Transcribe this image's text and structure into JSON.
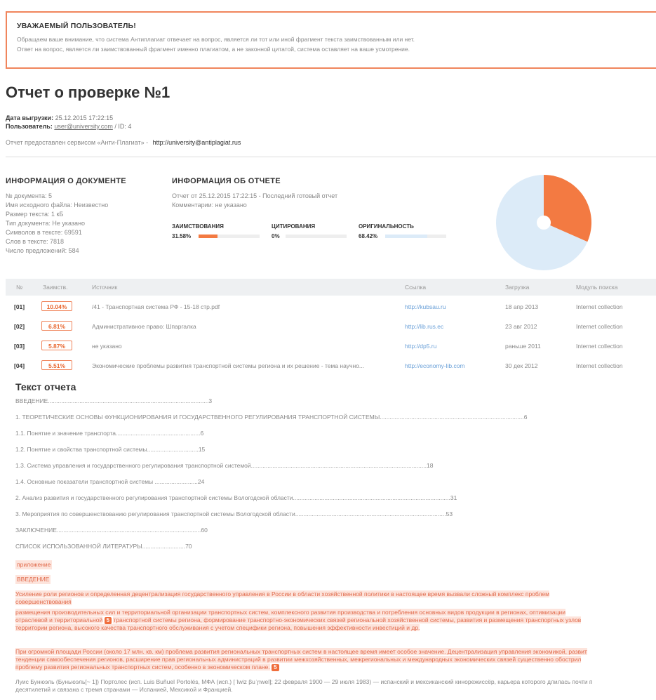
{
  "notice": {
    "title": "УВАЖАЕМЫЙ ПОЛЬЗОВАТЕЛЬ!",
    "line1": "Обращаем ваше внимание, что система Антиплагиат отвечает на вопрос, является ли тот или иной фрагмент текста заимствованным или нет.",
    "line2": "Ответ на вопрос, является ли заимствованный фрагмент именно плагиатом, а не законной цитатой, система оставляет на ваше усмотрение."
  },
  "report": {
    "title": "Отчет о проверке №1",
    "export_label": "Дата выгрузки:",
    "export_date": "25.12.2015 17:22:15",
    "user_label": "Пользователь:",
    "user_email": "user@university.com",
    "user_id": "/ ID: 4",
    "provided_text": "Отчет предоставлен сервисом «Анти-Плагиат» -",
    "provided_url": "http://university@antiplagiat.rus"
  },
  "doc_info": {
    "heading": "ИНФОРМАЦИЯ О ДОКУМЕНТЕ",
    "lines": [
      "№ документа: 5",
      "Имя исходного файла: Неизвестно",
      "Размер текста: 1 кБ",
      "Тип документа: Не указано",
      "Символов в тексте: 69591",
      "Слов в тексте: 7818",
      "Число предложений: 584"
    ]
  },
  "report_info": {
    "heading": "ИНФОРМАЦИЯ ОБ ОТЧЕТЕ",
    "line1": "Отчет от 25.12.2015 17:22:15 - Последний готовый отчет",
    "line2": "Комментарии: не указано",
    "metrics": [
      {
        "label": "ЗАИМСТВОВАНИЯ",
        "value": "31.58%",
        "fraction": 0.3158,
        "color": "#f37a42"
      },
      {
        "label": "ЦИТИРОВАНИЯ",
        "value": "0%",
        "fraction": 0.0,
        "color": "#9ec9e8"
      },
      {
        "label": "ОРИГИНАЛЬНОСТЬ",
        "value": "68.42%",
        "fraction": 0.6842,
        "color": "#dcebf8"
      }
    ]
  },
  "pie": {
    "slices": [
      {
        "label": "borrowed",
        "fraction": 0.3158,
        "color": "#f37a42"
      },
      {
        "label": "original",
        "fraction": 0.6842,
        "color": "#dcebf8"
      }
    ]
  },
  "table": {
    "headers": [
      "№",
      "Заимств.",
      "Источник",
      "Ссылка",
      "Загрузка",
      "Модуль поиска"
    ],
    "rows": [
      {
        "num": "[01]",
        "pct": "10.04%",
        "source": "/41 - Транспортная система РФ - 15-18 стр.pdf",
        "link": "http://kubsau.ru",
        "date": "18 апр 2013",
        "module": "Internet collection"
      },
      {
        "num": "[02]",
        "pct": "6.81%",
        "source": "Административное право: Шпаргалка",
        "link": "http://lib.rus.ec",
        "date": "23 авг 2012",
        "module": "Internet collection"
      },
      {
        "num": "[03]",
        "pct": "5.87%",
        "source": "не указано",
        "link": "http://dp5.ru",
        "date": "раньше 2011",
        "module": "Internet collection"
      },
      {
        "num": "[04]",
        "pct": "5.51%",
        "source": "Экономические проблемы развития транспортной системы региона и их решение - тема научно...",
        "link": "http://economy-lib.com",
        "date": "30 дек 2012",
        "module": "Internet collection"
      }
    ]
  },
  "text": {
    "title": "Текст отчета",
    "toc": [
      "ВВЕДЕНИЕ.................................................................................................3",
      "1. ТЕОРЕТИЧЕСКИЕ ОСНОВЫ ФУНКЦИОНИРОВАНИЯ И ГОСУДАРСТВЕННОГО РЕГУЛИРОВАНИЯ ТРАНСПОРТНОЙ СИСТЕМЫ.......................................................................................6",
      "1.1. Понятие и значение транспорта...................................................6",
      "1.2. Понятие и свойства транспортной системы...............................15",
      "1.3. Система управления и государственного регулирования транспортной системой..........................................................................................................18",
      "1.4. Основные показатели транспортной системы ..........................24",
      "2. Анализ развития и государственного регулирования транспортной системы Вологодской области...............................................................................................31",
      "3. Мероприятия по совершенствованию регулирования транспортной системы Вологодской области...........................................................................................53",
      "ЗАКЛЮЧЕНИЕ.......................................................................................60",
      "СПИСОК ИСПОЛЬЗОВАННОЙ ЛИТЕРАТУРЫ..........................70"
    ],
    "hl1": "приложение",
    "hl2": "ВВЕДЕНИЕ",
    "p1a": "Усиление роли регионов и определенная децентрализация государственного управления в России в области хозяйственной политики в настоящее время вызвали сложный комплекс проблем",
    "p1b": "совершенствования",
    "p2a": "размещения производительных сил и территориальной организации транспортных систем, комплексного развития производства и потребления основных видов продукции в регионах, оптимизации",
    "p2b": "отраслевой и территориальной",
    "p2mark": "5",
    "p2c": "транспортной системы региона, формирование транспортно-экономических связей региональной хозяйственной системы, развития и размещения транспортных узлов",
    "p2d": "территории региона, высокого качества транспортного обслуживания с учетом специфики региона, повышения эффективности инвестиций и др.",
    "p3a": "При огромной площади России (около 17 млн. кв. км) проблема развития региональных транспортных систем в настоящее время имеет особое значение. Децентрализация управления экономикой, развит",
    "p3b": "тенденции самообеспечения регионов, расширение прав региональных администраций в развитии межхозяйственных, межрегиональных и международных экономических связей существенно обострил",
    "p3c": "проблему развития региональных транспортных систем, особенно в экономическом плане.",
    "p3mark": "5",
    "p4a": "Луис Бунюэль (Буньюэль[~ 1]) Портолес (исп. Luis Buñuel Portolés, МФА (исп.) [ˈlwiz βuˈɲwel]; 22 февраля 1900 — 29 июля 1983) — испанский и мексиканский кинорежиссёр, карьера которого длилась почти п",
    "p4b": "десятилетий и связана с тремя странами — Испанией, Мексикой и Францией."
  }
}
